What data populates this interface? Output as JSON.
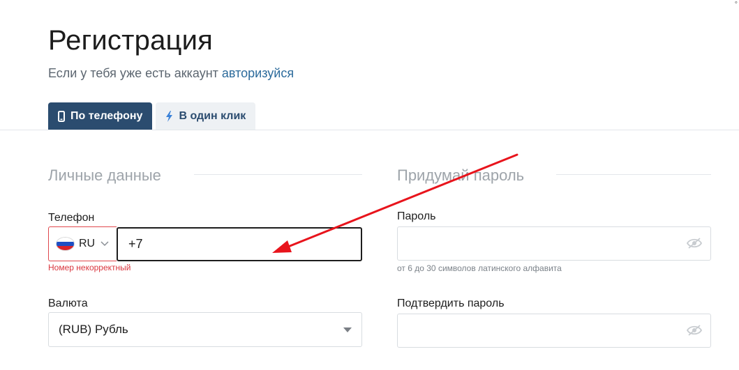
{
  "header": {
    "title": "Регистрация",
    "subtitle_text": "Если у тебя уже есть аккаунт ",
    "login_link": "авторизуйся"
  },
  "tabs": [
    {
      "label": "По телефону",
      "icon": "phone-icon",
      "active": true
    },
    {
      "label": "В один клик",
      "icon": "lightning-icon",
      "active": false
    }
  ],
  "personal": {
    "section_title": "Личные данные",
    "phone_label": "Телефон",
    "country_code": "RU",
    "country_flag": "russia-flag-icon",
    "phone_value": "+7",
    "phone_error": "Номер некорректный",
    "currency_label": "Валюта",
    "currency_value": "(RUB) Рубль"
  },
  "password": {
    "section_title": "Придумай пароль",
    "password_label": "Пароль",
    "password_hint": "от 6 до 30 символов латинского алфавита",
    "confirm_label": "Подтвердить пароль",
    "toggle_icon": "eye-hidden-icon"
  },
  "colors": {
    "accent": "#2b4c6f",
    "link": "#2b6a9b",
    "error": "#d9363e",
    "annotation_arrow": "#e8141c"
  }
}
